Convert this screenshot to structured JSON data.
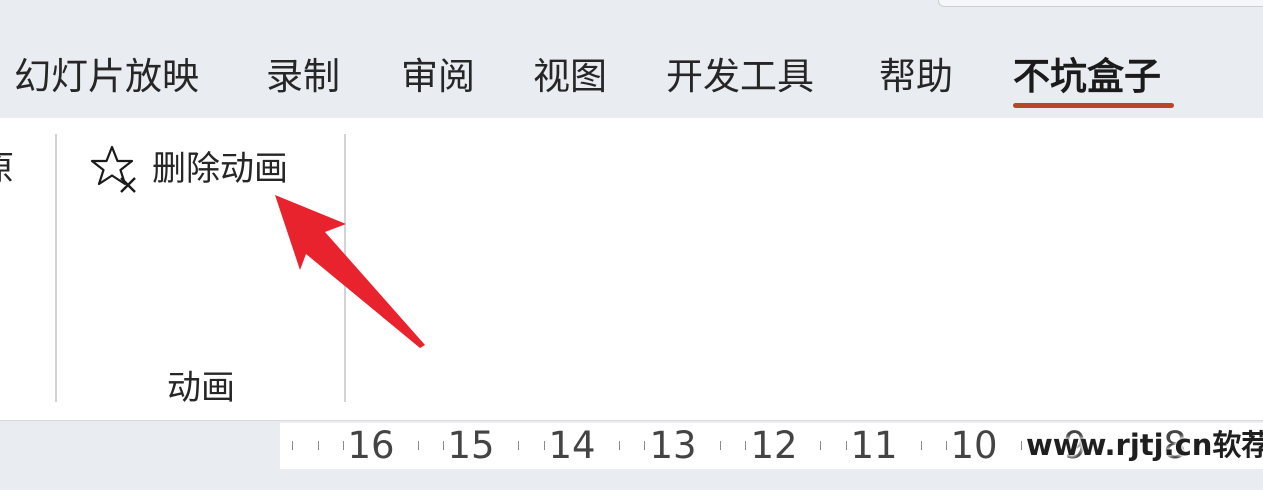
{
  "ribbon_tabs": [
    {
      "label": "幻灯片放映"
    },
    {
      "label": "录制"
    },
    {
      "label": "审阅"
    },
    {
      "label": "视图"
    },
    {
      "label": "开发工具"
    },
    {
      "label": "帮助"
    },
    {
      "label": "不坑盒子",
      "active": true
    }
  ],
  "ribbon": {
    "clipped_prev_group_char": "原",
    "animation_group": {
      "delete_animation_button": {
        "label": "删除动画",
        "icon": "star-delete-icon"
      },
      "group_label": "动画"
    }
  },
  "annotation": {
    "arrow_color": "#e8232d"
  },
  "accent_color": "#b7472a",
  "ruler": {
    "numbers": [
      "16",
      "15",
      "14",
      "13",
      "12",
      "11",
      "10",
      "9",
      "8"
    ]
  },
  "watermark": "www.rjtj.cn软荐网"
}
